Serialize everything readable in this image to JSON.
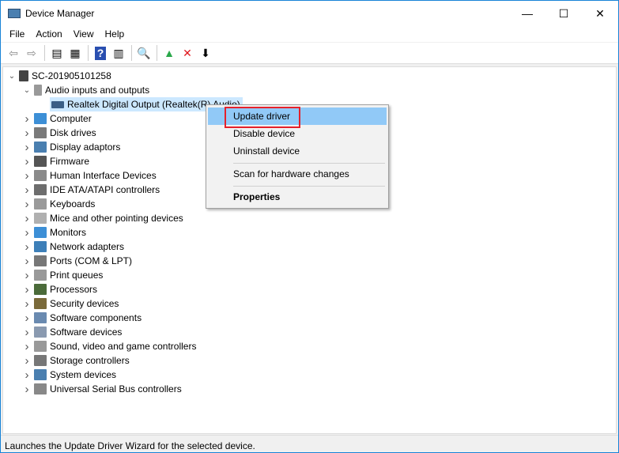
{
  "window": {
    "title": "Device Manager",
    "minimize": "—",
    "maximize": "☐",
    "close": "✕"
  },
  "menu": [
    "File",
    "Action",
    "View",
    "Help"
  ],
  "toolbar": [
    {
      "icon": "back-arrow-icon",
      "glyph": "⇦"
    },
    {
      "icon": "forward-arrow-icon",
      "glyph": "⇨"
    },
    {
      "icon": "show-hide-console-tree-icon",
      "glyph": "▤"
    },
    {
      "icon": "properties-icon",
      "glyph": "▦"
    },
    {
      "icon": "help-icon",
      "glyph": "?"
    },
    {
      "icon": "action-pane-icon",
      "glyph": "▥"
    },
    {
      "icon": "scan-hardware-icon",
      "glyph": "🔍"
    },
    {
      "icon": "update-driver-icon",
      "glyph": "▲"
    },
    {
      "icon": "uninstall-icon",
      "glyph": "✕"
    },
    {
      "icon": "disable-device-icon",
      "glyph": "⬇"
    }
  ],
  "tree": {
    "root": "SC-201905101258",
    "expanded": {
      "label": "Audio inputs and outputs",
      "child": "Realtek Digital Output (Realtek(R) Audio)"
    },
    "categories": [
      {
        "label": "Computer",
        "color": "#3d8fd6"
      },
      {
        "label": "Disk drives",
        "color": "#7a7a7a"
      },
      {
        "label": "Display adaptors",
        "color": "#4a7fb0"
      },
      {
        "label": "Firmware",
        "color": "#555555"
      },
      {
        "label": "Human Interface Devices",
        "color": "#8a8a8a"
      },
      {
        "label": "IDE ATA/ATAPI controllers",
        "color": "#6d6d6d"
      },
      {
        "label": "Keyboards",
        "color": "#9a9a9a"
      },
      {
        "label": "Mice and other pointing devices",
        "color": "#b0b0b0"
      },
      {
        "label": "Monitors",
        "color": "#3d8fd6"
      },
      {
        "label": "Network adapters",
        "color": "#3d7fb8"
      },
      {
        "label": "Ports (COM & LPT)",
        "color": "#777777"
      },
      {
        "label": "Print queues",
        "color": "#999999"
      },
      {
        "label": "Processors",
        "color": "#4b6b3a"
      },
      {
        "label": "Security devices",
        "color": "#7a6a3a"
      },
      {
        "label": "Software components",
        "color": "#6a8ab0"
      },
      {
        "label": "Software devices",
        "color": "#8a9ab0"
      },
      {
        "label": "Sound, video and game controllers",
        "color": "#999999"
      },
      {
        "label": "Storage controllers",
        "color": "#777777"
      },
      {
        "label": "System devices",
        "color": "#4a7fb0"
      },
      {
        "label": "Universal Serial Bus controllers",
        "color": "#888888"
      }
    ]
  },
  "context_menu": {
    "update": "Update driver",
    "disable": "Disable device",
    "uninstall": "Uninstall device",
    "scan": "Scan for hardware changes",
    "properties": "Properties"
  },
  "status": "Launches the Update Driver Wizard for the selected device."
}
